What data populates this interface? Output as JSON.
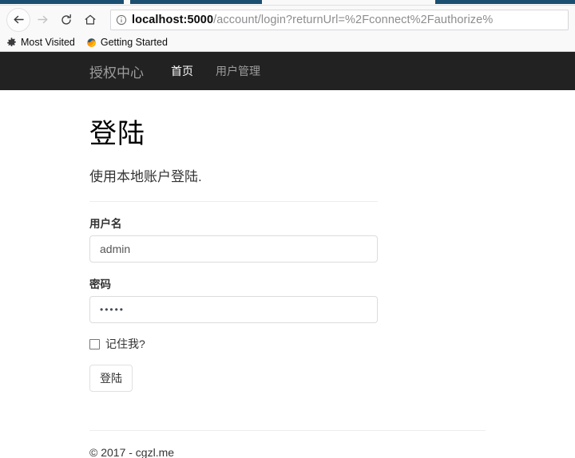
{
  "browser": {
    "toolbar": {
      "back_label": "Back",
      "forward_label": "Forward",
      "reload_label": "Reload",
      "home_label": "Home"
    },
    "urlbar": {
      "info_icon": "info-circle-icon",
      "host": "localhost:5000",
      "path": "/account/login?returnUrl=%2Fconnect%2Fauthorize%"
    },
    "bookmarks": [
      {
        "icon": "gear-icon",
        "label": "Most Visited"
      },
      {
        "icon": "firefox-icon",
        "label": "Getting Started"
      }
    ]
  },
  "site": {
    "navbar": {
      "brand": "授权中心",
      "links": [
        {
          "label": "首页",
          "active": true
        },
        {
          "label": "用户管理",
          "active": false
        }
      ]
    },
    "login": {
      "title": "登陆",
      "subtitle": "使用本地账户登陆.",
      "username_label": "用户名",
      "username_value": "admin",
      "username_placeholder": "",
      "password_label": "密码",
      "password_value": "•••••",
      "password_placeholder": "",
      "remember_label": "记住我?",
      "remember_checked": false,
      "submit_label": "登陆"
    },
    "footer": {
      "copyright": "© 2017 - cgzl.me"
    }
  },
  "colors": {
    "navbar_bg": "#222222",
    "navbar_link": "#9d9d9d",
    "navbar_link_active": "#ffffff",
    "tab_accent": "#1b4f72",
    "page_bg": "#ffffff"
  }
}
